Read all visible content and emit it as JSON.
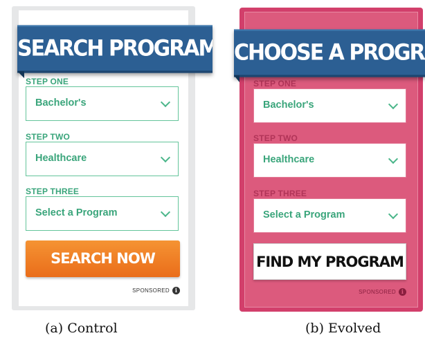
{
  "control": {
    "title": "SEARCH PROGRAMS",
    "steps": [
      {
        "label": "STEP ONE",
        "value": "Bachelor's"
      },
      {
        "label": "STEP TWO",
        "value": "Healthcare"
      },
      {
        "label": "STEP THREE",
        "value": "Select a Program"
      }
    ],
    "cta_label": "SEARCH NOW",
    "sponsored": "SPONSORED",
    "caption": "(a) Control"
  },
  "evolved": {
    "title": "CHOOSE A PROGRAM",
    "steps": [
      {
        "label": "STEP ONE",
        "value": "Bachelor's"
      },
      {
        "label": "STEP TWO",
        "value": "Healthcare"
      },
      {
        "label": "STEP THREE",
        "value": "Select a Program"
      }
    ],
    "cta_label": "FIND MY PROGRAM",
    "sponsored": "SPONSORED",
    "caption": "(b) Evolved"
  },
  "icons": {
    "dropdown": "chevron-down-icon",
    "info": "info-icon"
  },
  "colors": {
    "banner": "#2c5f93",
    "control_accent": "#3aa57b",
    "control_cta": "#f0801f",
    "evolved_background": "#d23f6b",
    "evolved_cta": "#ffffff"
  }
}
